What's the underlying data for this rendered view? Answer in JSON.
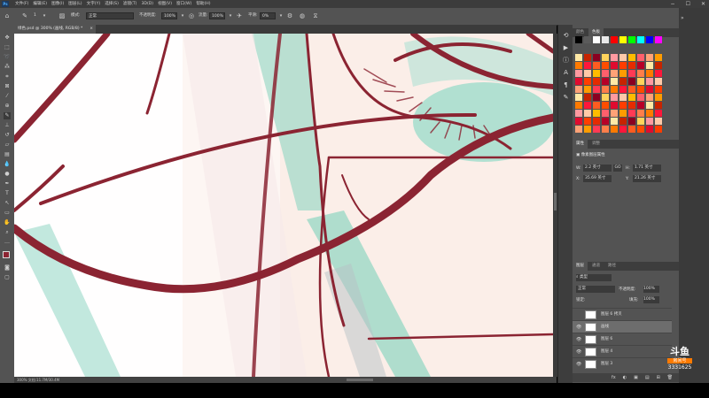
{
  "menubar": {
    "items": [
      "文件(F)",
      "编辑(E)",
      "图像(I)",
      "图层(L)",
      "文字(Y)",
      "选择(S)",
      "滤镜(T)",
      "3D(D)",
      "视图(V)",
      "窗口(W)",
      "帮助(H)"
    ],
    "controls": [
      "−",
      "☐",
      "✕"
    ]
  },
  "options": {
    "brush_size": "1",
    "mode_label": "模式:",
    "mode_value": "正常",
    "opacity_label": "不透明度:",
    "opacity_value": "100%",
    "flow_label": "流量:",
    "flow_value": "100%",
    "smooth_label": "平滑:",
    "smooth_value": "0%"
  },
  "document": {
    "tab_title": "绿色.psd @ 300% (画线, RGB/8) *",
    "tab_close": "×",
    "status": "300%   文档:11.7M/30.4M"
  },
  "swatches": {
    "tabs": [
      "颜色",
      "色板"
    ],
    "top_row": [
      "#000000",
      "#5b5b5b",
      "#ffffff",
      "#e9e9e9",
      "#ff0000",
      "#ffff00",
      "#00ff00",
      "#00ffff",
      "#0000ff",
      "#ff00ff"
    ],
    "grid_palette": [
      "#ffe9a6",
      "#ffd45c",
      "#ffbc00",
      "#ff9c00",
      "#ff7a00",
      "#ff4d00",
      "#e52b00",
      "#c72400",
      "#ff9aa0",
      "#ff5f6c",
      "#ff3a54",
      "#ff173b",
      "#e00b2f",
      "#b70027",
      "#8a0021",
      "#ffc9a8",
      "#ffa277",
      "#ff7e4a",
      "#ff5c20",
      "#ff3d00"
    ]
  },
  "properties": {
    "tabs": [
      "属性",
      "调整"
    ],
    "type_label": "像素图层属性",
    "w_label": "W:",
    "w_value": "2.2 英寸",
    "go_label": "GO",
    "h_label": "H:",
    "h_value": "1.71 英寸",
    "x_label": "X:",
    "x_value": "35.69 英寸",
    "y_label": "Y:",
    "y_value": "21.26 英寸"
  },
  "layers": {
    "tabs": [
      "图层",
      "通道",
      "路径"
    ],
    "filter_label": "类型",
    "blend_mode": "正常",
    "opacity_label": "不透明度:",
    "opacity_value": "100%",
    "lock_label": "锁定:",
    "fill_label": "填充:",
    "fill_value": "100%",
    "rows": [
      {
        "name": "图层 6 拷贝",
        "visible": false
      },
      {
        "name": "画线",
        "visible": true,
        "selected": true
      },
      {
        "name": "图层 6",
        "visible": true
      },
      {
        "name": "图层 4",
        "visible": true
      },
      {
        "name": "图层 3",
        "visible": true
      }
    ],
    "footer_icons": [
      "fx",
      "◐",
      "▣",
      "▤",
      "⊞",
      "🗑"
    ]
  },
  "watermark": {
    "logo": "斗鱼",
    "sub": "房间号",
    "room": "3331625"
  },
  "colors": {
    "stroke": "#8b2432",
    "teal": "#8fd6c2",
    "canvas_bg": "#fbeee8",
    "ui_dark": "#535353"
  }
}
